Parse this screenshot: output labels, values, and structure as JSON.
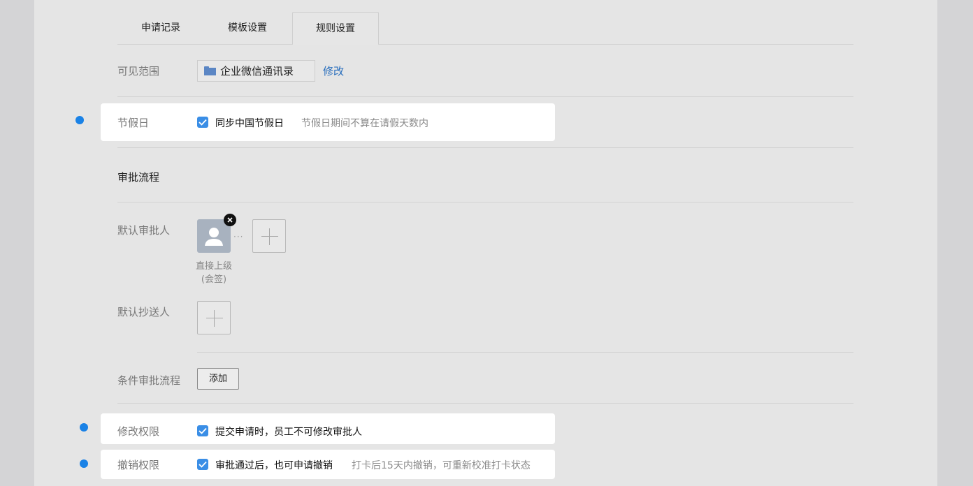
{
  "tabs": [
    {
      "label": "申请记录",
      "active": false
    },
    {
      "label": "模板设置",
      "active": false
    },
    {
      "label": "规则设置",
      "active": true
    }
  ],
  "visible_scope": {
    "label": "可见范围",
    "value": "企业微信通讯录",
    "icon": "folder-icon",
    "edit_link": "修改"
  },
  "holiday": {
    "label": "节假日",
    "checkbox_label": "同步中国节假日",
    "checked": true,
    "hint": "节假日期间不算在请假天数内"
  },
  "approval_flow": {
    "title": "审批流程",
    "default_approver": {
      "label": "默认审批人",
      "name_line1": "直接上级",
      "name_line2": "(会签)"
    },
    "default_cc": {
      "label": "默认抄送人"
    },
    "conditional": {
      "label": "条件审批流程",
      "add_button": "添加"
    }
  },
  "modify_permission": {
    "label": "修改权限",
    "checkbox_label": "提交申请时，员工不可修改审批人",
    "checked": true
  },
  "revoke_permission": {
    "label": "撤销权限",
    "checkbox_label": "审批通过后，也可申请撤销",
    "checked": true,
    "hint": "打卡后15天内撤销，可重新校准打卡状态"
  },
  "colors": {
    "accent": "#3a8ee6",
    "dot": "#1a82e6",
    "link": "#2a6fbd"
  }
}
